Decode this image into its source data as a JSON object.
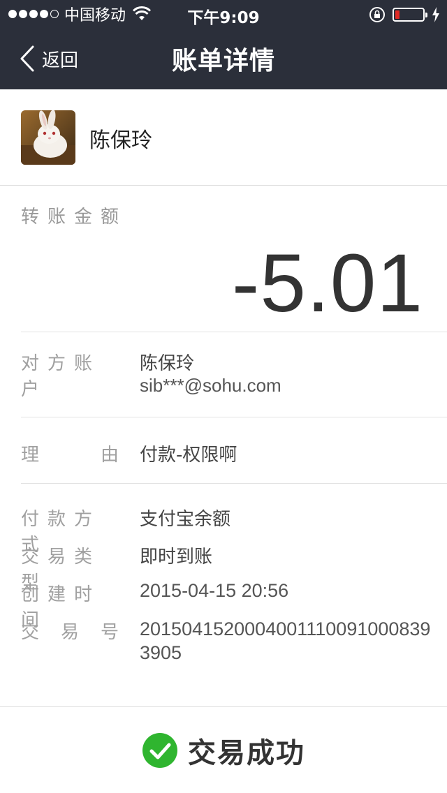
{
  "status_bar": {
    "carrier": "中国移动",
    "time": "下午9:09",
    "signal_filled": 4,
    "signal_total": 5,
    "battery_level": 0.15,
    "battery_color": "#e02a25"
  },
  "nav": {
    "back_label": "返回",
    "title": "账单详情",
    "background": "#2b2f3a"
  },
  "user": {
    "name": "陈保玲"
  },
  "amount": {
    "label": "转账金额",
    "value": "-5.01"
  },
  "details": {
    "account": {
      "label": "对方账户",
      "name": "陈保玲",
      "email": "sib***@sohu.com"
    },
    "reason": {
      "label_left": "理",
      "label_right": "由",
      "value": "付款-权限啊"
    },
    "payment_method": {
      "label": "付款方式",
      "value": "支付宝余额"
    },
    "trade_type": {
      "label": "交易类型",
      "value": "即时到账"
    },
    "created_time": {
      "label": "创建时间",
      "value": "2015-04-15 20:56"
    },
    "trade_no": {
      "label_chars": [
        "交",
        "易",
        "号"
      ],
      "value": "20150415200040011100910008393905"
    }
  },
  "result": {
    "text": "交易成功",
    "icon": "check-circle-icon",
    "color": "#2fb52f"
  }
}
